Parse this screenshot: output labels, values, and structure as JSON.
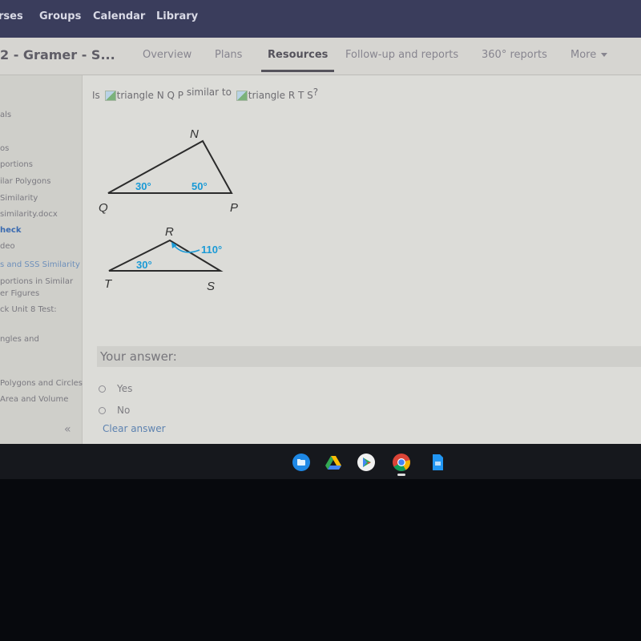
{
  "top_nav": {
    "items": [
      "rses",
      "Groups",
      "Calendar",
      "Library"
    ]
  },
  "course_header": {
    "title": "2 - Gramer - S...",
    "tabs": [
      {
        "label": "Overview",
        "active": false
      },
      {
        "label": "Plans",
        "active": false
      },
      {
        "label": "Resources",
        "active": true
      },
      {
        "label": "Follow-up and reports",
        "active": false
      },
      {
        "label": "360° reports",
        "active": false
      },
      {
        "label": "More",
        "active": false
      }
    ]
  },
  "sidebar": {
    "items": [
      {
        "label": "als"
      },
      {
        "label": "os"
      },
      {
        "label": "portions"
      },
      {
        "label": "ilar Polygons"
      },
      {
        "label": "Similarity"
      },
      {
        "label": "similarity.docx"
      },
      {
        "label": "heck",
        "state": "active"
      },
      {
        "label": "deo"
      },
      {
        "label": "s and SSS Similarity",
        "state": "link"
      },
      {
        "label": "portions in Similar"
      },
      {
        "label": "er Figures"
      },
      {
        "label": "ck Unit 8 Test:"
      },
      {
        "label": "ngles and"
      },
      {
        "label": "Polygons and Circles"
      },
      {
        "label": "Area and Volume"
      }
    ],
    "collapse_glyph": "«"
  },
  "question": {
    "prefix": "Is",
    "image1_alt": "triangle N Q P",
    "middle": "similar to",
    "image2_alt": "triangle R T S",
    "suffix": "?"
  },
  "figure": {
    "triangle1": {
      "vertices": {
        "top": "N",
        "left": "Q",
        "right": "P"
      },
      "angles": {
        "Q": "30°",
        "P": "50°"
      }
    },
    "triangle2": {
      "vertices": {
        "top": "R",
        "left": "T",
        "right": "S"
      },
      "angles": {
        "T": "30°",
        "R": "110°"
      }
    },
    "accent_color": "#1a9ad6"
  },
  "answer": {
    "label": "Your answer:",
    "options": [
      "Yes",
      "No"
    ],
    "clear_label": "Clear answer"
  },
  "shelf": {
    "apps": [
      "files-icon",
      "google-drive-icon",
      "play-store-icon",
      "chrome-icon",
      "google-docs-icon"
    ]
  }
}
